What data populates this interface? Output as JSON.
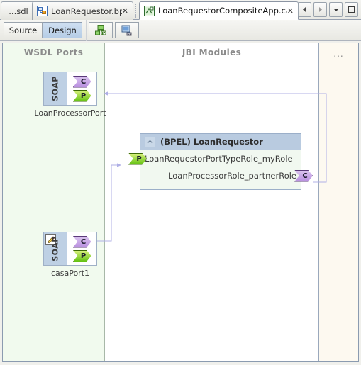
{
  "window": {
    "nav_buttons": [
      {
        "name": "scroll-left-button",
        "glyph": "◀"
      },
      {
        "name": "scroll-right-button",
        "glyph": "▶"
      },
      {
        "name": "tab-list-button",
        "glyph": "▼"
      },
      {
        "name": "maximize-button",
        "glyph": "□"
      }
    ]
  },
  "tabs": [
    {
      "label": "...sdl",
      "active": false,
      "modified": false,
      "closable": false,
      "icon": "wsdl-file-icon"
    },
    {
      "label": "LoanRequestor.bpel",
      "active": false,
      "modified": false,
      "closable": true,
      "icon": "bpel-file-icon",
      "close": "✕"
    },
    {
      "label": "LoanRequestorCompositeApp.casa *",
      "active": true,
      "modified": true,
      "closable": true,
      "icon": "casa-file-icon",
      "close": "✕"
    }
  ],
  "toolbar": {
    "source_label": "Source",
    "design_label": "Design",
    "selected": "Design",
    "buttons": [
      {
        "name": "source-view-button",
        "label": "Source"
      },
      {
        "name": "design-view-button",
        "label": "Design"
      },
      {
        "name": "build-project-button",
        "label": ""
      },
      {
        "name": "deploy-project-button",
        "label": ""
      }
    ]
  },
  "canvas": {
    "columns": [
      {
        "id": "wsdl",
        "title": "WSDL Ports"
      },
      {
        "id": "jbi",
        "title": "JBI Modules"
      },
      {
        "id": "more",
        "title": "..."
      }
    ],
    "wsdl_ports": [
      {
        "name": "LoanProcessorPort",
        "binding": "SOAP",
        "editable": false,
        "endpoints": [
          {
            "kind": "consume",
            "glyph": "C"
          },
          {
            "kind": "provide",
            "glyph": "P"
          }
        ]
      },
      {
        "name": "casaPort1",
        "binding": "SOAP",
        "editable": true,
        "edit_icon": "pencil-icon",
        "endpoints": [
          {
            "kind": "consume",
            "glyph": "C"
          },
          {
            "kind": "provide",
            "glyph": "P"
          }
        ]
      }
    ],
    "jbi_modules": [
      {
        "title": "(BPEL) LoanRequestor",
        "collapse_icon": "collapse-chevron-icon",
        "roles": [
          {
            "label": "LoanRequestorPortTypeRole_myRole",
            "endpoint": "provide",
            "glyph": "P",
            "side": "left"
          },
          {
            "label": "LoanProcessorRole_partnerRole",
            "endpoint": "consume",
            "glyph": "C",
            "side": "right"
          }
        ]
      }
    ],
    "more_label": "..."
  },
  "colors": {
    "consume_endpoint": "#b98fe0",
    "provide_endpoint": "#63c111",
    "wsdl_column_bg": "#f1faee",
    "jbi_column_bg": "#ffffff",
    "more_column_bg": "#fdf9f0",
    "bpel_header_bg": "#b9cbe0",
    "soap_bar_bg": "#bed0e4",
    "connector_line": "#a9a9e8",
    "selected_button_bg": "#b6cde6"
  }
}
